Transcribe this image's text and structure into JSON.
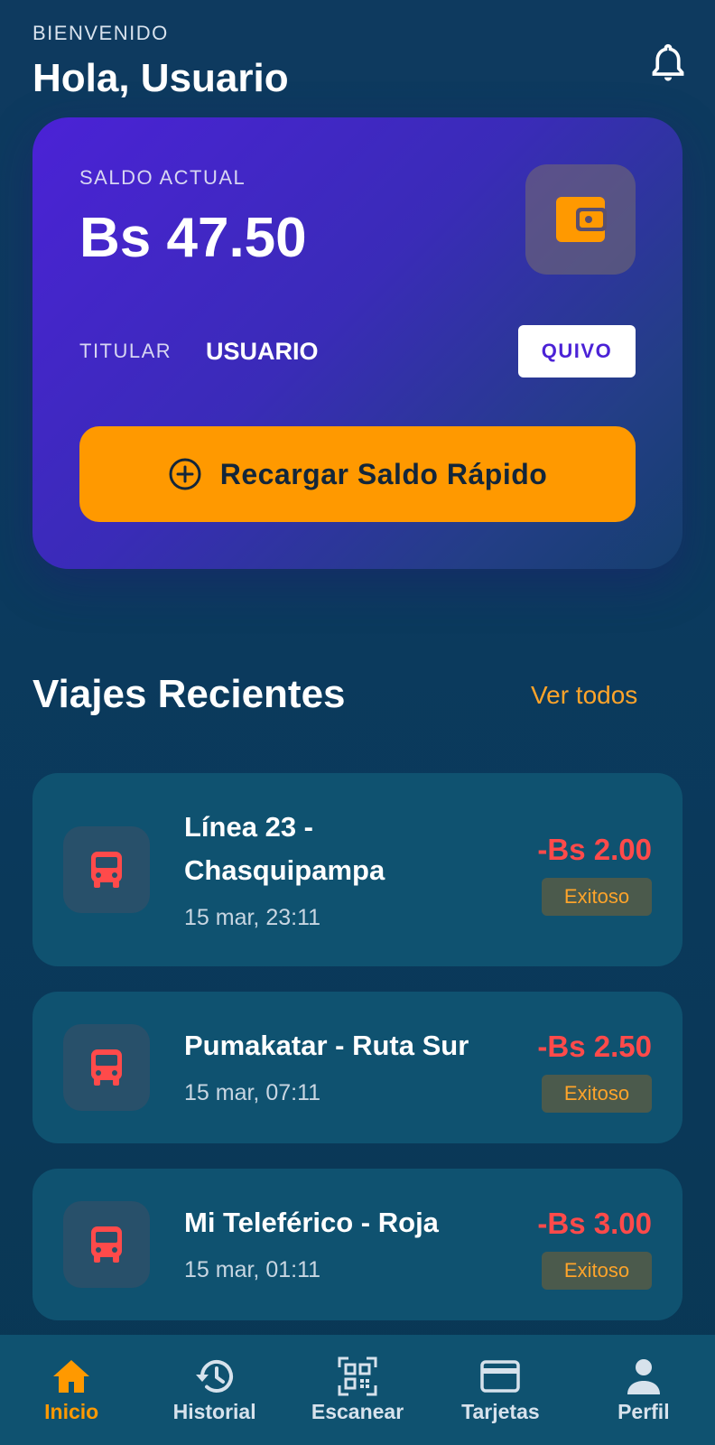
{
  "header": {
    "welcome": "BIENVENIDO",
    "greeting": "Hola, Usuario"
  },
  "card": {
    "balance_label": "SALDO ACTUAL",
    "balance_value": "Bs 47.50",
    "holder_label": "TITULAR",
    "holder_value": "USUARIO",
    "brand": "QUIVO",
    "recharge_label": "Recargar Saldo Rápido"
  },
  "section": {
    "title": "Viajes Recientes",
    "see_all": "Ver todos"
  },
  "trips": [
    {
      "name_line1": "Línea 23 -",
      "name_line2": "Chasquipampa",
      "date": "15 mar, 23:11",
      "amount": "-Bs 2.00",
      "status": "Exitoso"
    },
    {
      "name_line1": "Pumakatar - Ruta Sur",
      "date": "15 mar, 07:11",
      "amount": "-Bs 2.50",
      "status": "Exitoso"
    },
    {
      "name_line1": "Mi Teleférico - Roja",
      "date": "15 mar, 01:11",
      "amount": "-Bs 3.00",
      "status": "Exitoso"
    }
  ],
  "nav": [
    {
      "label": "Inicio",
      "icon": "home-icon",
      "active": true
    },
    {
      "label": "Historial",
      "icon": "history-icon",
      "active": false
    },
    {
      "label": "Escanear",
      "icon": "qr-scan-icon",
      "active": false
    },
    {
      "label": "Tarjetas",
      "icon": "credit-card-icon",
      "active": false
    },
    {
      "label": "Perfil",
      "icon": "person-icon",
      "active": false
    }
  ],
  "colors": {
    "accent": "#ff9900",
    "card_gradient_start": "#4b22d6",
    "negative_amount": "#ff4a4a",
    "background": "#0e3a5f"
  }
}
